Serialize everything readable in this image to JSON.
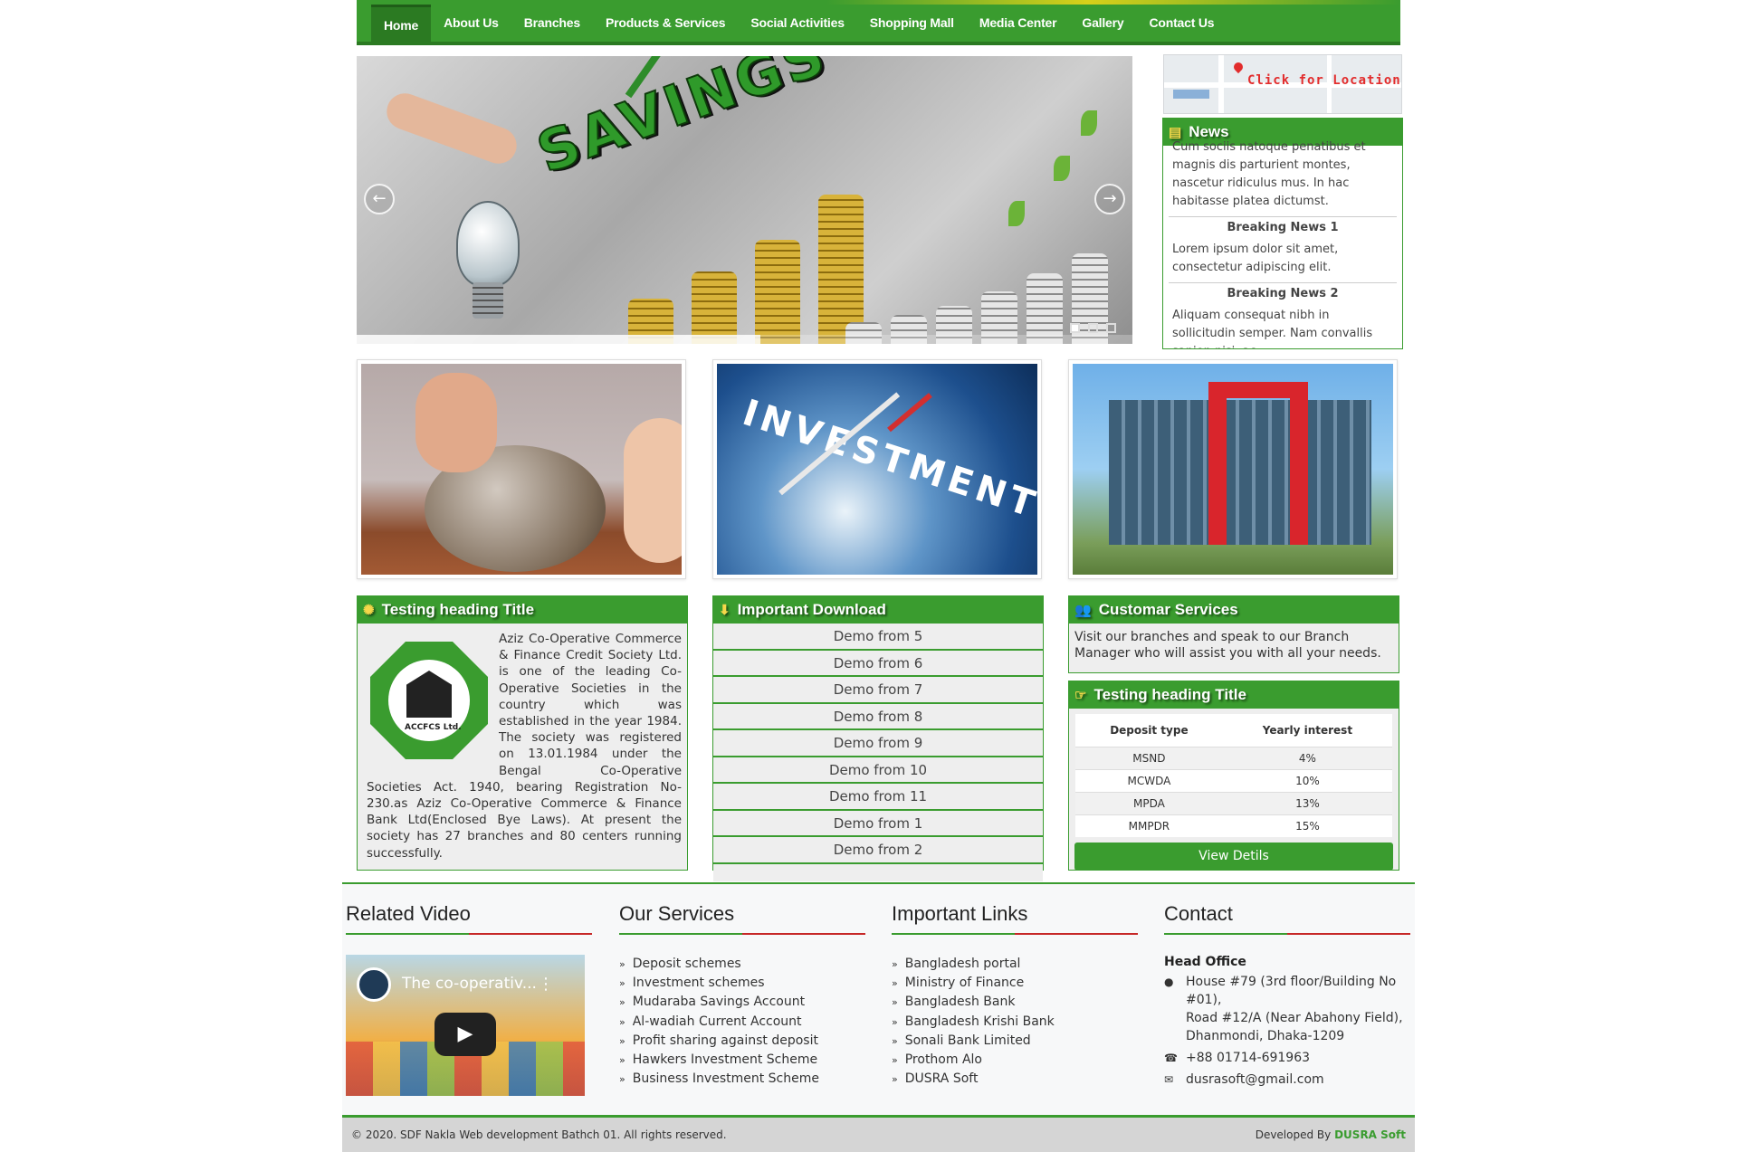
{
  "nav": {
    "items": [
      "Home",
      "About Us",
      "Branches",
      "Products & Services",
      "Social Activities",
      "Shopping Mall",
      "Media Center",
      "Gallery",
      "Contact Us"
    ]
  },
  "slider": {
    "banner_text": "SAVINGS",
    "prev_glyph": "←",
    "next_glyph": "→",
    "dots": 3,
    "active_dot": 1,
    "progress": 0.52
  },
  "map": {
    "label": "Click for Location"
  },
  "news": {
    "title": "News",
    "intro": "Cum sociis natoque penatibus et magnis dis parturient montes, nascetur ridiculus mus. In hac habitasse platea dictumst.",
    "items": [
      {
        "title": "Breaking News 1",
        "text": "Lorem ipsum dolor sit amet, consectetur adipiscing elit."
      },
      {
        "title": "Breaking News 2",
        "text": "Aliquam consequat nibh in sollicitudin semper. Nam convallis sapien nisi, ac"
      }
    ]
  },
  "tiles": {
    "investment_text": "INVESTMENT"
  },
  "about": {
    "title": "Testing heading Title",
    "logo_text": "ACCFCS Ltd.",
    "text": "Aziz Co-Operative Commerce & Finance Credit Society Ltd. is one of the leading Co-Operative Societies in the country which was established in the year 1984. The society was registered on 13.01.1984 under the Bengal Co-Operative Societies Act. 1940, bearing Registration No-230.as Aziz Co-Operative Commerce & Finance Bank Ltd(Enclosed Bye Laws). At present the society has 27 branches and 80 centers running successfully."
  },
  "downloads": {
    "title": "Important Download",
    "items": [
      "Demo from 5",
      "Demo from 6",
      "Demo from 7",
      "Demo from 8",
      "Demo from 9",
      "Demo from 10",
      "Demo from 11",
      "Demo from 1",
      "Demo from 2"
    ]
  },
  "customer": {
    "title": "Customar Services",
    "text": "Visit our branches and speak to our Branch Manager who will assist you with all your needs."
  },
  "rates": {
    "title": "Testing heading Title",
    "headers": [
      "Deposit type",
      "Yearly interest"
    ],
    "rows": [
      [
        "MSND",
        "4%"
      ],
      [
        "MCWDA",
        "10%"
      ],
      [
        "MPDA",
        "13%"
      ],
      [
        "MMPDR",
        "15%"
      ]
    ],
    "button": "View Detils"
  },
  "footer": {
    "video": {
      "title": "Related Video",
      "caption": "The co-operativ..."
    },
    "services": {
      "title": "Our Services",
      "items": [
        "Deposit schemes",
        "Investment schemes",
        "Mudaraba Savings Account",
        "Al-wadiah Current Account",
        "Profit sharing against deposit",
        "Hawkers Investment Scheme",
        "Business Investment Scheme"
      ]
    },
    "links": {
      "title": "Important Links",
      "items": [
        "Bangladesh portal",
        "Ministry of Finance",
        "Bangladesh Bank",
        "Bangladesh Krishi Bank",
        "Sonali Bank Limited",
        "Prothom Alo",
        "DUSRA Soft"
      ]
    },
    "contact": {
      "title": "Contact",
      "head_office": "Head Office",
      "address": [
        "House #79 (3rd floor/Building No #01),",
        "Road #12/A (Near Abahony Field),",
        "Dhanmondi, Dhaka-1209"
      ],
      "phone": "+88 01714-691963",
      "email": "dusrasoft@gmail.com"
    }
  },
  "copyright": {
    "text": "© 2020. SDF Nakla Web development Bathch 01. All rights reserved.",
    "dev_label": "Developed By",
    "dev_brand": "DUSRA Soft"
  },
  "colors": {
    "brand_green": "#3a9c2f",
    "accent_red": "#c62828",
    "accent_yellow": "#d8d01a"
  }
}
